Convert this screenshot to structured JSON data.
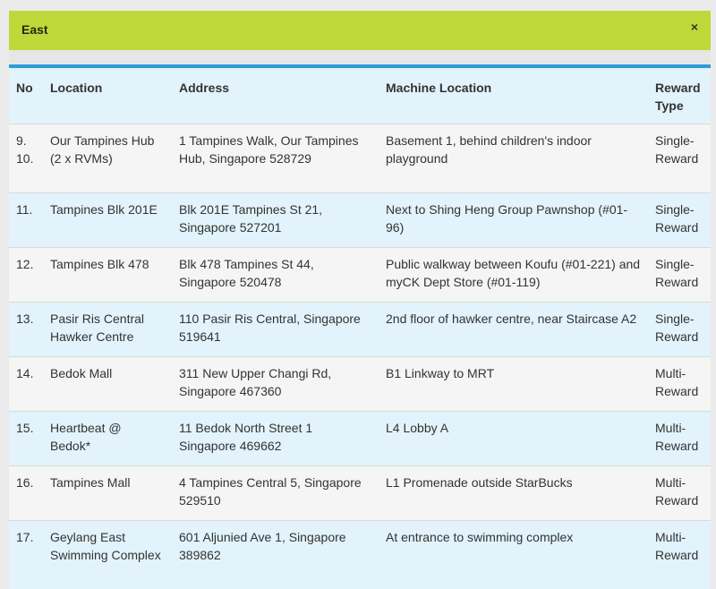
{
  "header": {
    "title": "East",
    "close_icon": "×"
  },
  "table": {
    "columns": [
      "No",
      "Location",
      "Address",
      "Machine Location",
      "Reward Type"
    ],
    "rows": [
      {
        "no": "9.\n10.",
        "location": "Our Tampines Hub (2 x RVMs)",
        "address": "1 Tampines Walk, Our Tampines Hub, Singapore 528729",
        "machine": "Basement 1, behind children's indoor playground",
        "reward": "Single-Reward"
      },
      {
        "no": "11.",
        "location": "Tampines Blk 201E",
        "address": "Blk 201E Tampines St 21, Singapore 527201",
        "machine": "Next to Shing Heng Group Pawnshop (#01-96)",
        "reward": "Single-Reward"
      },
      {
        "no": "12.",
        "location": "Tampines Blk 478",
        "address": "Blk 478 Tampines St 44, Singapore 520478",
        "machine": "Public walkway between Koufu (#01-221) and myCK Dept Store (#01-119)",
        "reward": "Single-Reward"
      },
      {
        "no": "13.",
        "location": "Pasir Ris Central Hawker Centre",
        "address": "110 Pasir Ris Central, Singapore 519641",
        "machine": "2nd floor of hawker centre, near Staircase A2",
        "reward": "Single-Reward"
      },
      {
        "no": "14.",
        "location": "Bedok Mall",
        "address": "311 New Upper Changi Rd, Singapore 467360",
        "machine": "B1 Linkway to MRT",
        "reward": "Multi-Reward"
      },
      {
        "no": "15.",
        "location": "Heartbeat @ Bedok*",
        "address": "11 Bedok North Street 1 Singapore 469662",
        "machine": "L4 Lobby A",
        "reward": "Multi-Reward"
      },
      {
        "no": "16.",
        "location": "Tampines Mall",
        "address": "4 Tampines Central 5, Singapore 529510",
        "machine": "L1 Promenade outside StarBucks",
        "reward": "Multi-Reward"
      },
      {
        "no": "17.",
        "location": "Geylang East Swimming Complex",
        "address": "601 Aljunied Ave 1, Singapore 389862",
        "machine": "At entrance to swimming complex",
        "reward": "Multi-Reward"
      }
    ]
  },
  "colors": {
    "header_bg": "#bfd93a",
    "accent_border": "#2d9bd6",
    "row_alt": "#e2f3fb",
    "row_plain": "#f5f5f5"
  }
}
